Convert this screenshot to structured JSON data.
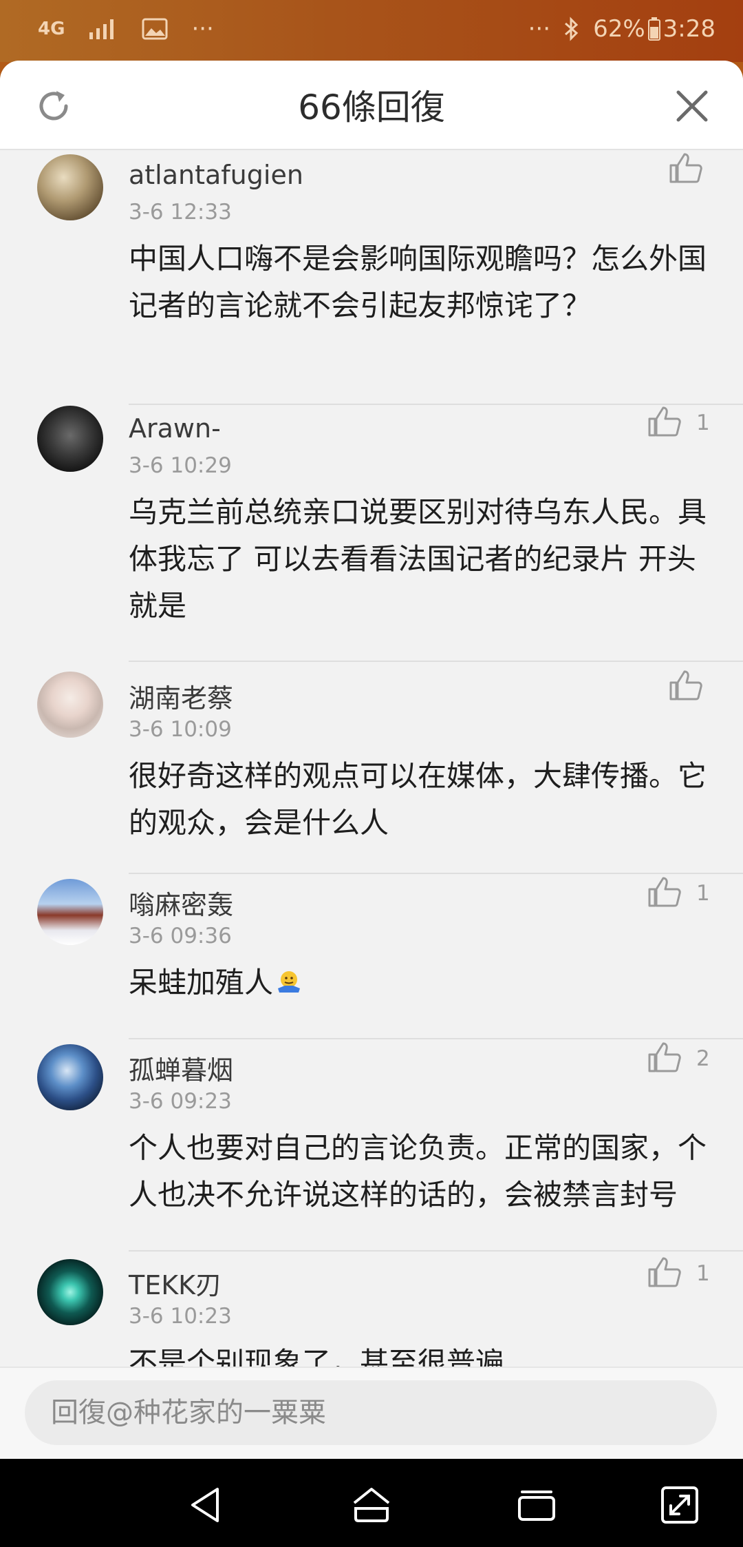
{
  "status_bar": {
    "network": "4G",
    "battery": "62%",
    "time": "3:28",
    "left_more": "···",
    "right_more": "···"
  },
  "header": {
    "title": "66條回復"
  },
  "comments": [
    {
      "username": "atlantafugien",
      "time": "3-6 12:33",
      "text": "中国人口嗨不是会影响国际观瞻吗？怎么外国记者的言论就不会引起友邦惊诧了？",
      "likes": ""
    },
    {
      "username": "Arawn-",
      "time": "3-6 10:29",
      "text": "乌克兰前总统亲口说要区别对待乌东人民。具体我忘了 可以去看看法国记者的纪录片 开头就是",
      "likes": "1"
    },
    {
      "username": "湖南老蔡",
      "time": "3-6 10:09",
      "text": "很好奇这样的观点可以在媒体，大肆传播。它的观众，会是什么人",
      "likes": ""
    },
    {
      "username": "嗡麻密轰",
      "time": "3-6 09:36",
      "text": "呆蛙加殖人",
      "likes": "1"
    },
    {
      "username": "孤蝉暮烟",
      "time": "3-6 09:23",
      "text": "个人也要对自己的言论负责。正常的国家，个人也决不允许说这样的话的，会被禁言封号",
      "likes": "2"
    },
    {
      "username": "TEKK刃",
      "time": "3-6 10:23",
      "text": "不是个别现象了，甚至很普遍",
      "likes": "1"
    }
  ],
  "reply": {
    "placeholder": "回復@种花家的一粟粟"
  },
  "colors": {
    "status_bar": "#a8541a",
    "sheet_background": "#f2f2f2",
    "header_background": "#ffffff",
    "text_primary": "#1e1e1e",
    "text_secondary": "#9a9a9a"
  },
  "icons": {
    "refresh": "refresh-icon",
    "close": "close-icon",
    "like": "thumbs-up-icon",
    "nav_back": "back-triangle-icon",
    "nav_home": "home-icon",
    "nav_recents": "recents-icon",
    "nav_expand": "expand-icon"
  }
}
